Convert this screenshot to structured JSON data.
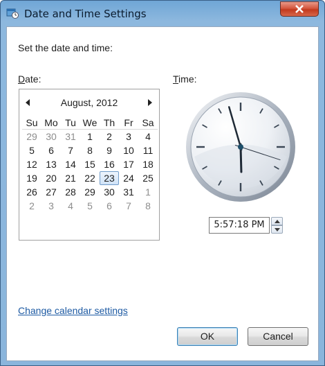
{
  "window": {
    "title": "Date and Time Settings",
    "title_icon": "clock-settings-icon",
    "close_icon": "close-icon"
  },
  "instructions": "Set the date and time:",
  "date_label": "Date:",
  "time_label": "Time:",
  "calendar": {
    "month_label": "August, 2012",
    "prev_icon": "chevron-left-icon",
    "next_icon": "chevron-right-icon",
    "weekdays": [
      "Su",
      "Mo",
      "Tu",
      "We",
      "Th",
      "Fr",
      "Sa"
    ],
    "weeks": [
      [
        "29",
        "30",
        "31",
        "1",
        "2",
        "3",
        "4"
      ],
      [
        "5",
        "6",
        "7",
        "8",
        "9",
        "10",
        "11"
      ],
      [
        "12",
        "13",
        "14",
        "15",
        "16",
        "17",
        "18"
      ],
      [
        "19",
        "20",
        "21",
        "22",
        "23",
        "24",
        "25"
      ],
      [
        "26",
        "27",
        "28",
        "29",
        "30",
        "31",
        "1"
      ],
      [
        "2",
        "3",
        "4",
        "5",
        "6",
        "7",
        "8"
      ]
    ],
    "selected_day": "23"
  },
  "clock": {
    "hour": 5,
    "minute": 57,
    "second": 18
  },
  "time_value": "5:57:18 PM",
  "spinner": {
    "up_icon": "arrow-up-icon",
    "down_icon": "arrow-down-icon"
  },
  "change_calendar_link": "Change calendar settings",
  "ok_label": "OK",
  "cancel_label": "Cancel",
  "colors": {
    "title_bar": "#8db8de",
    "close_button": "#c9452a",
    "link": "#1d5aa3",
    "selected_day_border": "#6f9bc9"
  }
}
